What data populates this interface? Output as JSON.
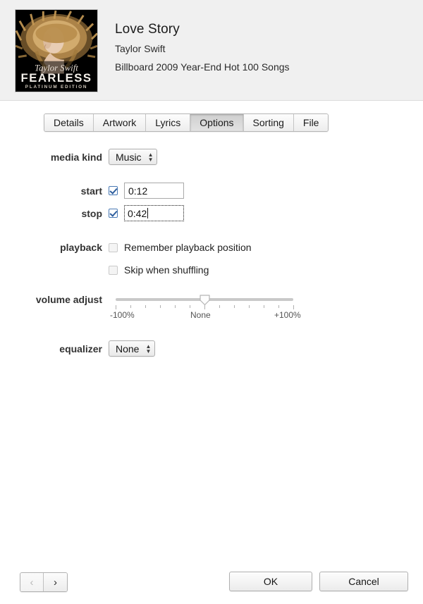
{
  "header": {
    "song_title": "Love Story",
    "artist": "Taylor Swift",
    "album": "Billboard 2009 Year-End Hot 100 Songs",
    "artwork": {
      "album_text": "FEARLESS",
      "edition_text": "PLATINUM EDITION",
      "signature_text": "Taylor Swift",
      "background_color": "#000000",
      "hair_color": "#c9a063"
    }
  },
  "tabs": [
    {
      "label": "Details",
      "active": false
    },
    {
      "label": "Artwork",
      "active": false
    },
    {
      "label": "Lyrics",
      "active": false
    },
    {
      "label": "Options",
      "active": true
    },
    {
      "label": "Sorting",
      "active": false
    },
    {
      "label": "File",
      "active": false
    }
  ],
  "form": {
    "media_kind": {
      "label": "media kind",
      "value": "Music"
    },
    "start": {
      "label": "start",
      "checked": true,
      "value": "0:12",
      "focused": false
    },
    "stop": {
      "label": "stop",
      "checked": true,
      "value": "0:42",
      "focused": true
    },
    "playback": {
      "label": "playback",
      "options": [
        {
          "label": "Remember playback position",
          "checked": false
        },
        {
          "label": "Skip when shuffling",
          "checked": false
        }
      ]
    },
    "volume_adjust": {
      "label": "volume adjust",
      "min_label": "-100%",
      "mid_label": "None",
      "max_label": "+100%",
      "value": 0,
      "tick_count": 13
    },
    "equalizer": {
      "label": "equalizer",
      "value": "None"
    }
  },
  "footer": {
    "prev_label": "‹",
    "next_label": "›",
    "ok_label": "OK",
    "cancel_label": "Cancel"
  }
}
